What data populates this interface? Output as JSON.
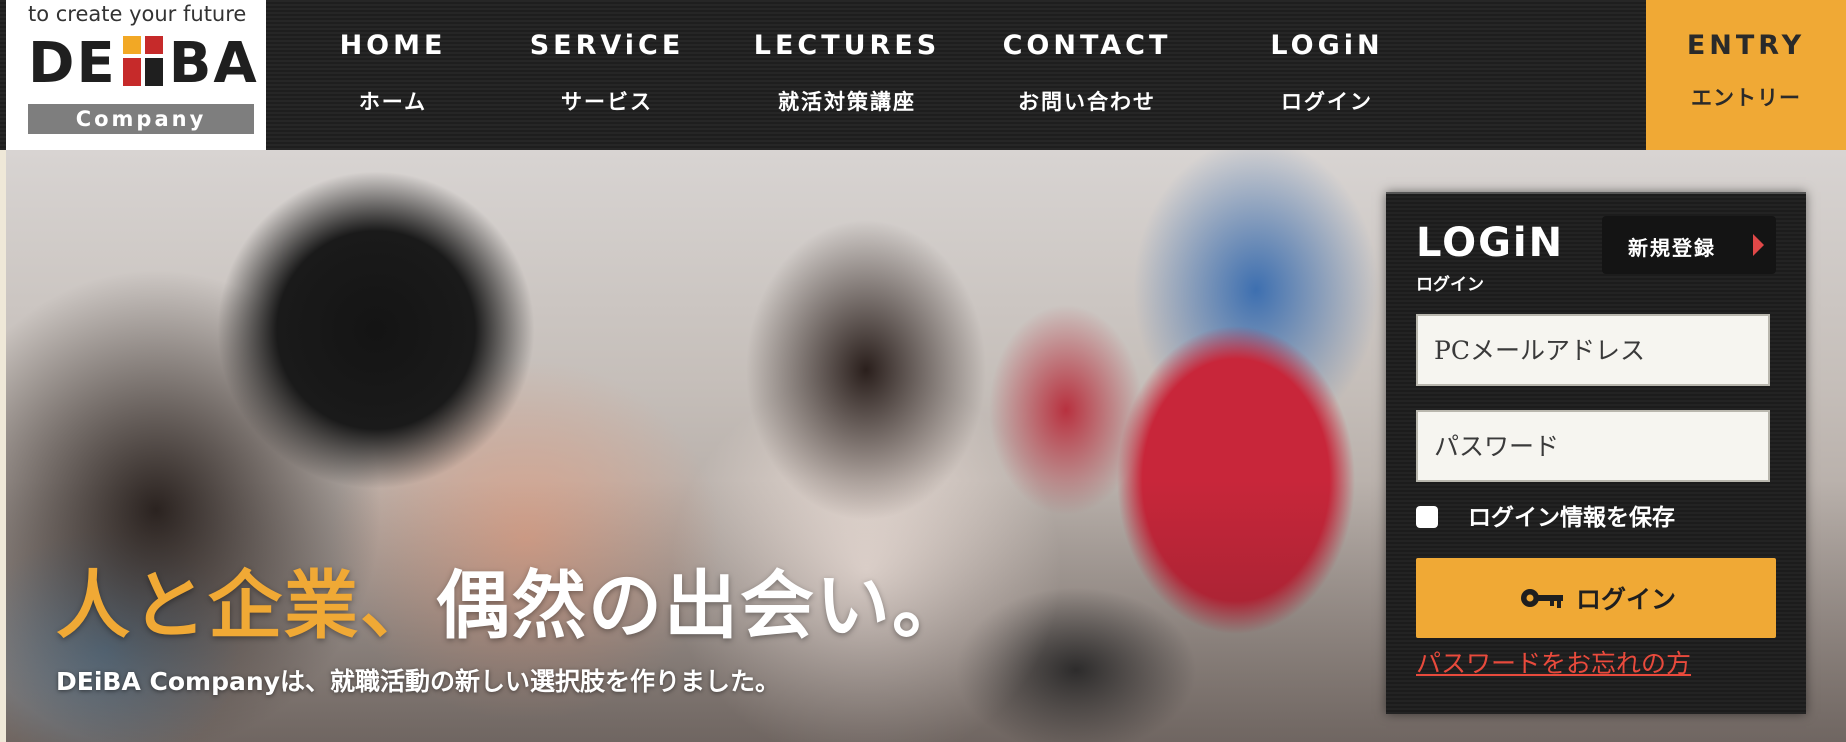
{
  "logo": {
    "tagline": "to create your future",
    "wordmark_left": "DE",
    "wordmark_right": "BA",
    "subtitle": "Company",
    "colors": {
      "orange": "#f2a825",
      "red": "#c62a2a",
      "dark": "#1f1f1f"
    }
  },
  "nav": {
    "items": [
      {
        "en": "HOME",
        "ja": "ホーム"
      },
      {
        "en": "SERViCE",
        "ja": "サービス"
      },
      {
        "en": "LECTURES",
        "ja": "就活対策講座"
      },
      {
        "en": "CONTACT",
        "ja": "お問い合わせ"
      },
      {
        "en": "LOGiN",
        "ja": "ログイン"
      }
    ],
    "entry": {
      "en": "ENTRY",
      "ja": "エントリー"
    }
  },
  "hero": {
    "headline_orange": "人と企業、",
    "headline_white": "偶然の出会い。",
    "subline": "DEiBA Companyは、就職活動の新しい選択肢を作りました。"
  },
  "login": {
    "title": "LOGiN",
    "title_ja": "ログイン",
    "register_label": "新規登録",
    "email_placeholder": "PCメールアドレス",
    "password_placeholder": "パスワード",
    "remember_label": "ログイン情報を保存",
    "remember_checked": false,
    "button_label": "ログイン",
    "forgot_label": "パスワードをお忘れの方"
  },
  "colors": {
    "accent": "#f0a935",
    "header_bg": "#222222",
    "link_red": "#e84a3c"
  },
  "icons": {
    "register_arrow": "triangle-right-icon",
    "login_button": "key-icon"
  }
}
